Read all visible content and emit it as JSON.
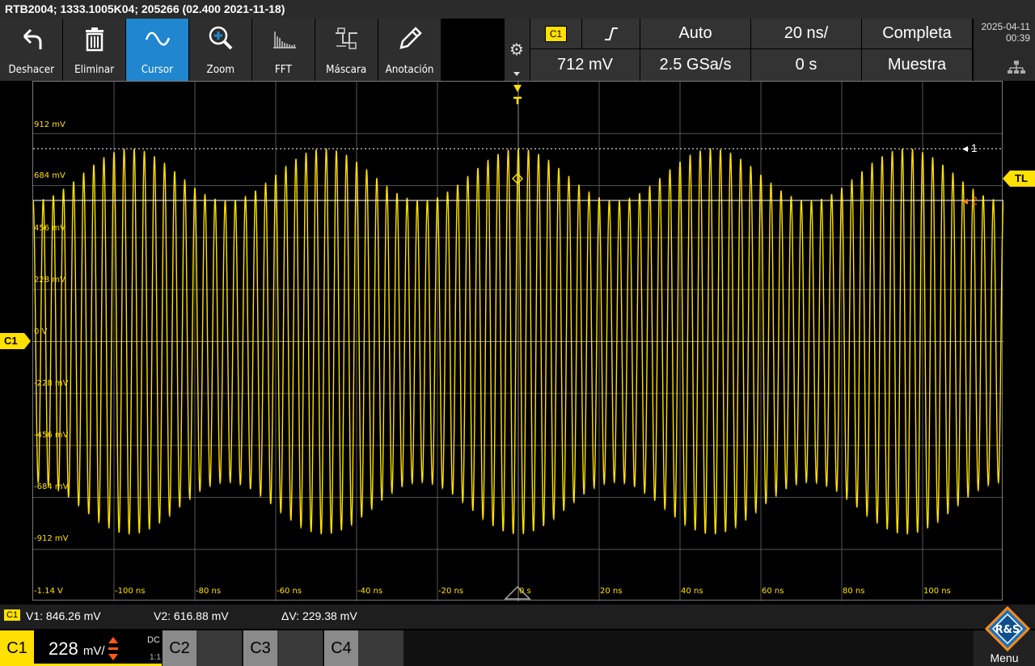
{
  "title_bar": {
    "text": "RTB2004; 1333.1005K04; 205266 (02.400 2021-11-18)"
  },
  "toolbar": {
    "buttons": [
      {
        "label": "Deshacer",
        "icon": "undo-icon",
        "active": false
      },
      {
        "label": "Eliminar",
        "icon": "trash-icon",
        "active": false
      },
      {
        "label": "Cursor",
        "icon": "cursor-wave-icon",
        "active": true
      },
      {
        "label": "Zoom",
        "icon": "zoom-icon",
        "active": false
      },
      {
        "label": "FFT",
        "icon": "fft-icon",
        "active": false
      },
      {
        "label": "Máscara",
        "icon": "mask-icon",
        "active": false
      },
      {
        "label": "Anotación",
        "icon": "pen-icon",
        "active": false
      }
    ]
  },
  "acquisition": {
    "trigger_source": "C1",
    "trigger_slope_icon": "rising-edge-icon",
    "trigger_mode": "Auto",
    "time_scale": "20 ns/",
    "acq_status": "Completa",
    "trigger_level": "712 mV",
    "sample_rate": "2.5 GSa/s",
    "time_offset": "0 s",
    "acq_mode": "Muestra"
  },
  "datetime": {
    "date": "2025-04-11",
    "time": "00:39"
  },
  "plot": {
    "y_labels": [
      "912 mV",
      "684 mV",
      "456 mV",
      "228 mV",
      "0 V",
      "-228 mV",
      "-456 mV",
      "-684 mV",
      "-912 mV",
      "-1.14 V"
    ],
    "x_labels": [
      "-100 ns",
      "-80 ns",
      "-60 ns",
      "-40 ns",
      "-20 ns",
      "0 s",
      "20 ns",
      "40 ns",
      "60 ns",
      "80 ns",
      "100 ns"
    ],
    "channel_marker": "C1",
    "trigger_level_marker": "TL",
    "cursor1_label": "1",
    "cursor2_label": "2",
    "trace_color": "#ffe000"
  },
  "chart_data": {
    "type": "line",
    "title": "",
    "xlabel": "",
    "ylabel": "",
    "xlim_ns": [
      -120,
      120
    ],
    "ylim_v": [
      -1.14,
      1.14
    ],
    "series": [
      {
        "carrier_period_ns": 2.5,
        "envelope_period_ns": 48,
        "max_peak_v": 0.846,
        "min_peak_v": 0.617
      }
    ],
    "cursors": {
      "v1_v": 0.84626,
      "v2_v": 0.61688
    },
    "grid": true
  },
  "measurements": {
    "badge": "C1",
    "v1": "V1: 846.26 mV",
    "v2": "V2: 616.88 mV",
    "dv": "ΔV: 229.38 mV"
  },
  "channels": {
    "c1": {
      "name": "C1",
      "scale_value": "228",
      "scale_unit": "mV/",
      "coupling": "DC",
      "ratio": "1:1"
    },
    "c2": {
      "name": "C2"
    },
    "c3": {
      "name": "C3"
    },
    "c4": {
      "name": "C4"
    }
  },
  "menu": {
    "label": "Menu",
    "logo_text": "R&S"
  }
}
